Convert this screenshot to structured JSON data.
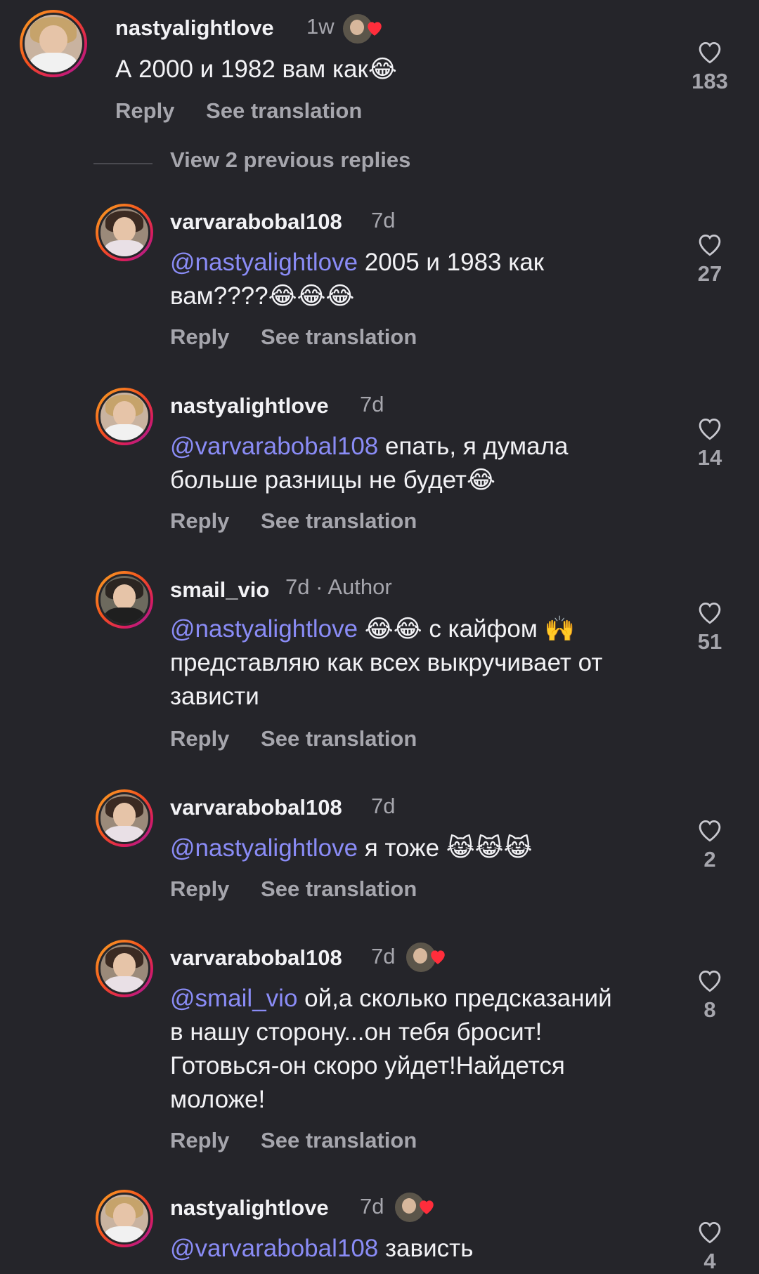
{
  "comments": [
    {
      "username": "nastyalightlove",
      "time": "1w",
      "text_plain": "А 2000 и 1982 вам как😂",
      "likes": "183",
      "liked_by_creator": true
    },
    {
      "username": "varvarabobal108",
      "time": "7d",
      "mention": "@nastyalightlove",
      "text": " 2005 и 1983 как вам????😂😂😂",
      "likes": "27"
    },
    {
      "username": "nastyalightlove",
      "time": "7d",
      "mention": "@varvarabobal108",
      "text": " епать, я думала больше разницы не будет😂",
      "likes": "14"
    },
    {
      "username": "smail_vio",
      "time": "7d",
      "author": "· Author",
      "mention": "@nastyalightlove",
      "text": " 😂😂 с кайфом 🙌 представляю как всех выкручивает от зависти",
      "likes": "51"
    },
    {
      "username": "varvarabobal108",
      "time": "7d",
      "mention": "@nastyalightlove",
      "text": " я тоже 😹😹😹",
      "likes": "2"
    },
    {
      "username": "varvarabobal108",
      "time": "7d",
      "mention": "@smail_vio",
      "text": " ой,а сколько предсказаний в нашу сторону...он тебя бросит!Готовься-он скоро уйдет!Найдется моложе!",
      "likes": "8",
      "liked_by_creator": true
    },
    {
      "username": "nastyalightlove",
      "time": "7d",
      "mention": "@varvarabobal108",
      "text": " зависть",
      "likes": "4",
      "liked_by_creator": true
    }
  ],
  "actions": {
    "reply": "Reply",
    "translate": "See translation"
  },
  "view_previous": "View 2 previous replies",
  "colors": {
    "background": "#25252a",
    "mention": "#8a8cf6",
    "muted": "#a6a6ad",
    "heart": "#ff2d3b"
  }
}
